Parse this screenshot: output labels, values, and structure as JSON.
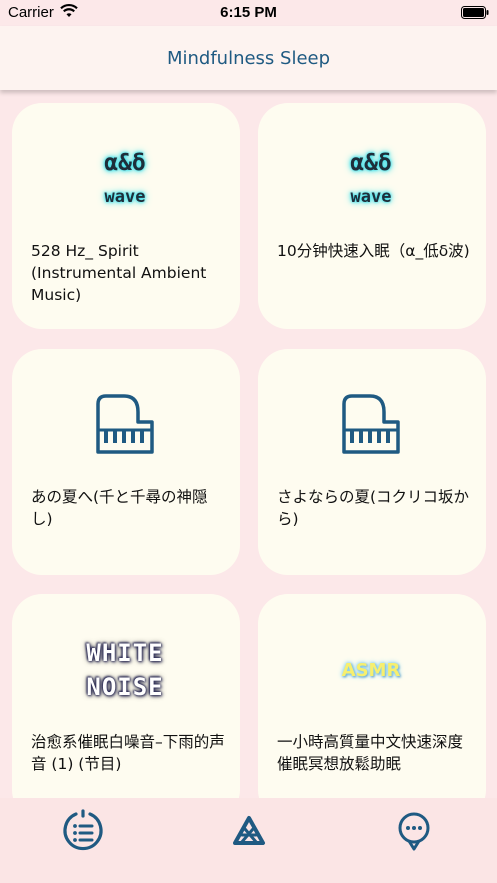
{
  "status_bar": {
    "carrier": "Carrier",
    "time": "6:15 PM"
  },
  "nav": {
    "title": "Mindfulness Sleep"
  },
  "cards": [
    {
      "label": "528 Hz_ Spirit (Instrumental Ambient Music)",
      "thumb_top": "α&δ",
      "thumb_bottom": "wave",
      "icon": "alpha-delta-wave-icon"
    },
    {
      "label": "10分钟快速入眠（α_低δ波)",
      "thumb_top": "α&δ",
      "thumb_bottom": "wave",
      "icon": "alpha-delta-wave-icon"
    },
    {
      "label": "あの夏へ(千と千尋の神隠し)",
      "icon": "piano-icon"
    },
    {
      "label": "さよならの夏(コクリコ坂から)",
      "icon": "piano-icon"
    },
    {
      "label": "治愈系催眠白噪音–下雨的声音 (1) (节目)",
      "thumb_top": "WHITE",
      "thumb_bottom": "NOISE",
      "icon": "white-noise-icon"
    },
    {
      "label": "一小時高質量中文快速深度催眠冥想放鬆助眠",
      "thumb_text": "ASMR",
      "icon": "asmr-icon"
    }
  ],
  "tabs": [
    {
      "icon": "list-icon"
    },
    {
      "icon": "triangle-logo-icon"
    },
    {
      "icon": "chat-icon"
    }
  ],
  "colors": {
    "accent": "#1f5a82",
    "background": "#fce8e9",
    "card": "#fefcf0",
    "glow": "#3fe0ea"
  }
}
